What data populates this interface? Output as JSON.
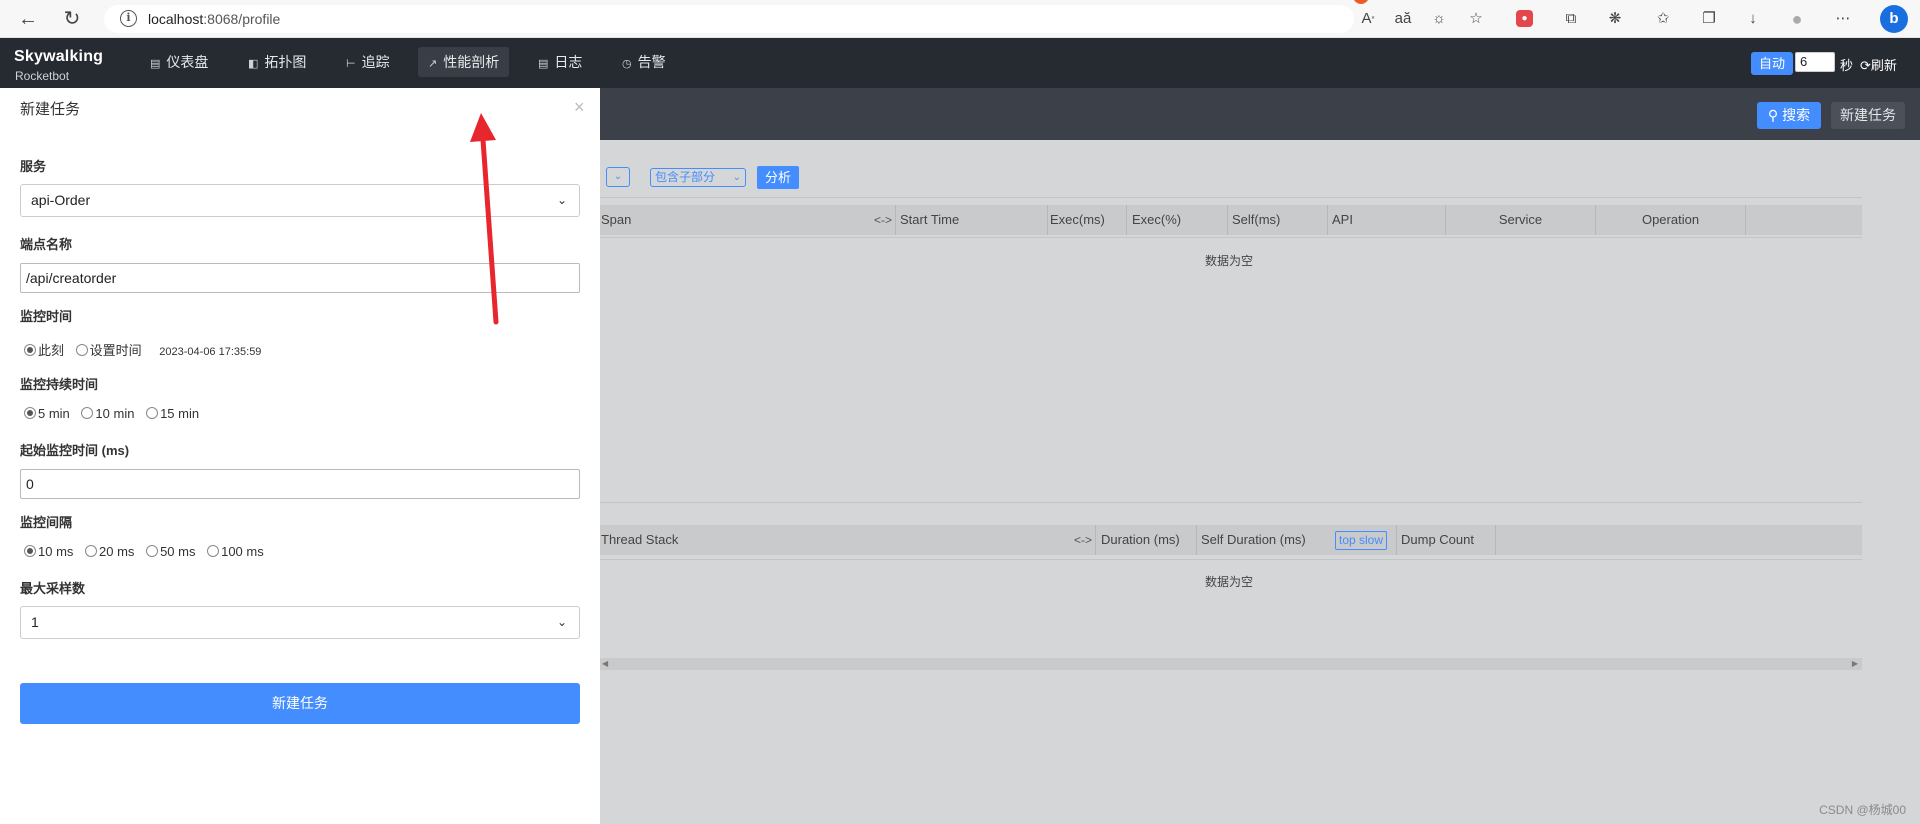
{
  "browser": {
    "url_host": "localhost",
    "url_rest": ":8068/profile"
  },
  "header": {
    "logo_main": "Skywalking",
    "logo_sub": "Rocketbot",
    "nav": [
      {
        "label": "仪表盘",
        "icon": "dashboard-icon"
      },
      {
        "label": "拓扑图",
        "icon": "topology-icon"
      },
      {
        "label": "追踪",
        "icon": "trace-icon"
      },
      {
        "label": "性能剖析",
        "icon": "profile-icon"
      },
      {
        "label": "日志",
        "icon": "log-icon"
      },
      {
        "label": "告警",
        "icon": "alarm-icon"
      }
    ],
    "active_nav": "性能剖析",
    "auto_label": "自动",
    "interval_value": "6",
    "seconds_label": "秒",
    "refresh_label": "刷新"
  },
  "toolbar": {
    "search_label": "搜索",
    "new_task_label": "新建任务"
  },
  "analysis": {
    "include_select": "包含子部分",
    "analyze_label": "分析"
  },
  "span_table": {
    "columns": [
      "Span",
      "Start Time",
      "Exec(ms)",
      "Exec(%)",
      "Self(ms)",
      "API",
      "Service",
      "Operation"
    ],
    "sort_icon": "<->",
    "empty_text": "数据为空"
  },
  "stack_table": {
    "columns": [
      "Thread Stack",
      "Duration (ms)",
      "Self Duration (ms)",
      "Dump Count"
    ],
    "top_slow_label": "top slow",
    "sort_icon": "<->",
    "empty_text": "数据为空"
  },
  "drawer": {
    "title": "新建任务",
    "service_label": "服务",
    "service_value": "api-Order",
    "endpoint_label": "端点名称",
    "endpoint_value": "/api/creatorder",
    "monitor_time_label": "监控时间",
    "monitor_time_options": [
      "此刻",
      "设置时间"
    ],
    "monitor_time_selected": "此刻",
    "monitor_time_value": "2023-04-06 17:35:59",
    "duration_label": "监控持续时间",
    "duration_options": [
      "5 min",
      "10 min",
      "15 min"
    ],
    "duration_selected": "5 min",
    "start_time_label": "起始监控时间 (ms)",
    "start_time_value": "0",
    "interval_label": "监控间隔",
    "interval_options": [
      "10 ms",
      "20 ms",
      "50 ms",
      "100 ms"
    ],
    "interval_selected": "10 ms",
    "max_sample_label": "最大采样数",
    "max_sample_value": "1",
    "submit_label": "新建任务"
  },
  "watermark": "CSDN @杨城00",
  "colors": {
    "accent": "#448dfe",
    "header_bg": "#262a31",
    "annotation": "#e8262d"
  }
}
